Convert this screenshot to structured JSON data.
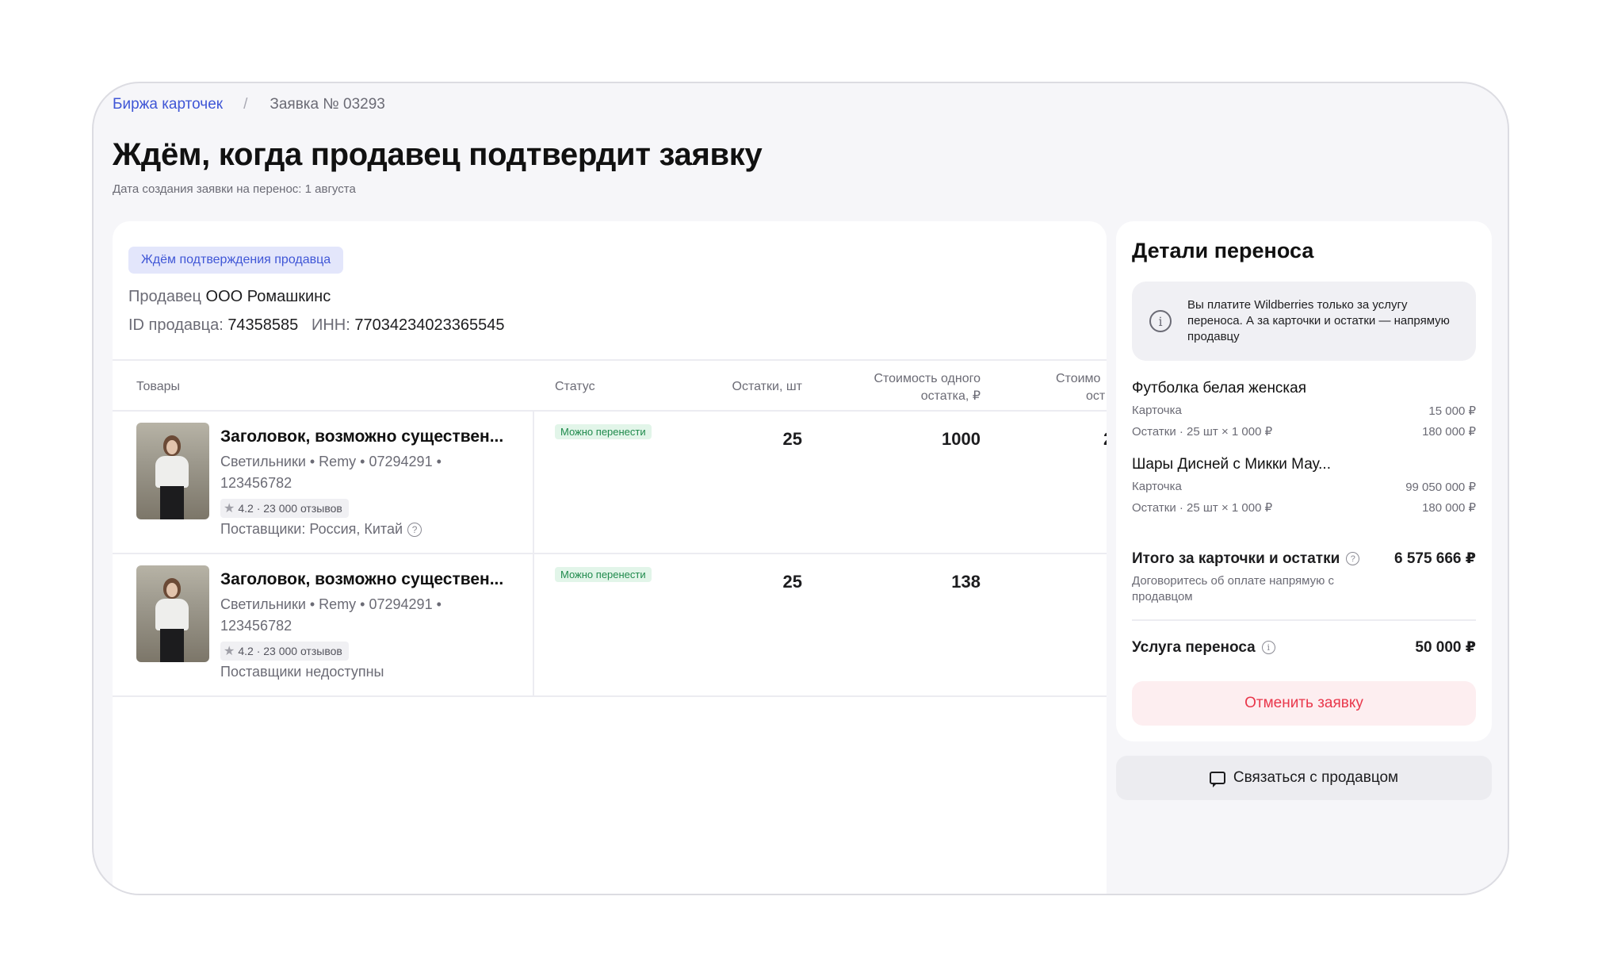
{
  "breadcrumb": {
    "link": "Биржа карточек",
    "separator": "/",
    "current": "Заявка № 03293"
  },
  "page": {
    "title": "Ждём, когда продавец подтвердит заявку",
    "subtitle": "Дата создания заявки на перенос: 1 августа"
  },
  "seller": {
    "status_pill": "Ждём подтверждения продавца",
    "seller_label": "Продавец",
    "seller_name": "ООО Ромашкинс",
    "id_label": "ID продавца:",
    "id_value": "74358585",
    "inn_label": "ИНН:",
    "inn_value": "77034234023365545"
  },
  "table": {
    "headers": {
      "products": "Товары",
      "status": "Статус",
      "stock": "Остатки, шт",
      "cost_line1": "Стоимость одного",
      "cost_line2": "остатка, ₽",
      "cost2_line1": "Стоимо",
      "cost2_line2": "ост"
    },
    "rows": [
      {
        "title": "Заголовок, возможно существен...",
        "meta_line1": "Светильники • Remy • 07294291 •",
        "meta_line2": "123456782",
        "rating": "4.2 · 23 000 отзывов",
        "suppliers": "Поставщики: Россия, Китай",
        "status": "Можно перенести",
        "stock": "25",
        "cost": "1000",
        "cost2": "2"
      },
      {
        "title": "Заголовок, возможно существен...",
        "meta_line1": "Светильники • Remy • 07294291 •",
        "meta_line2": "123456782",
        "rating": "4.2 · 23 000 отзывов",
        "suppliers": "Поставщики недоступны",
        "status": "Можно перенести",
        "stock": "25",
        "cost": "138",
        "cost2": ""
      }
    ]
  },
  "details": {
    "title": "Детали переноса",
    "info_text": "Вы платите Wildberries только за услугу переноса. А за карточки и остатки — напрямую продавцу",
    "items": [
      {
        "title": "Футболка белая женская",
        "card_label": "Карточка",
        "card_value": "15 000 ₽",
        "stock_label": "Остатки · 25 шт × 1 000 ₽",
        "stock_value": "180 000 ₽"
      },
      {
        "title": "Шары Дисней с Микки Мау...",
        "card_label": "Карточка",
        "card_value": "99 050 000 ₽",
        "stock_label": "Остатки · 25 шт × 1 000 ₽",
        "stock_value": "180 000 ₽"
      }
    ],
    "total_label": "Итого за карточки и остатки",
    "total_value": "6 575 666 ₽",
    "total_note": "Договоритесь об оплате напрямую с продавцом",
    "service_label": "Услуга переноса",
    "service_value": "50 000 ₽",
    "cancel_button": "Отменить заявку",
    "contact_button": "Связаться с продавцом"
  },
  "colors": {
    "accent": "#3f56d6",
    "success": "#1f8a4c",
    "danger": "#e9374b",
    "background": "#f6f6f9"
  }
}
